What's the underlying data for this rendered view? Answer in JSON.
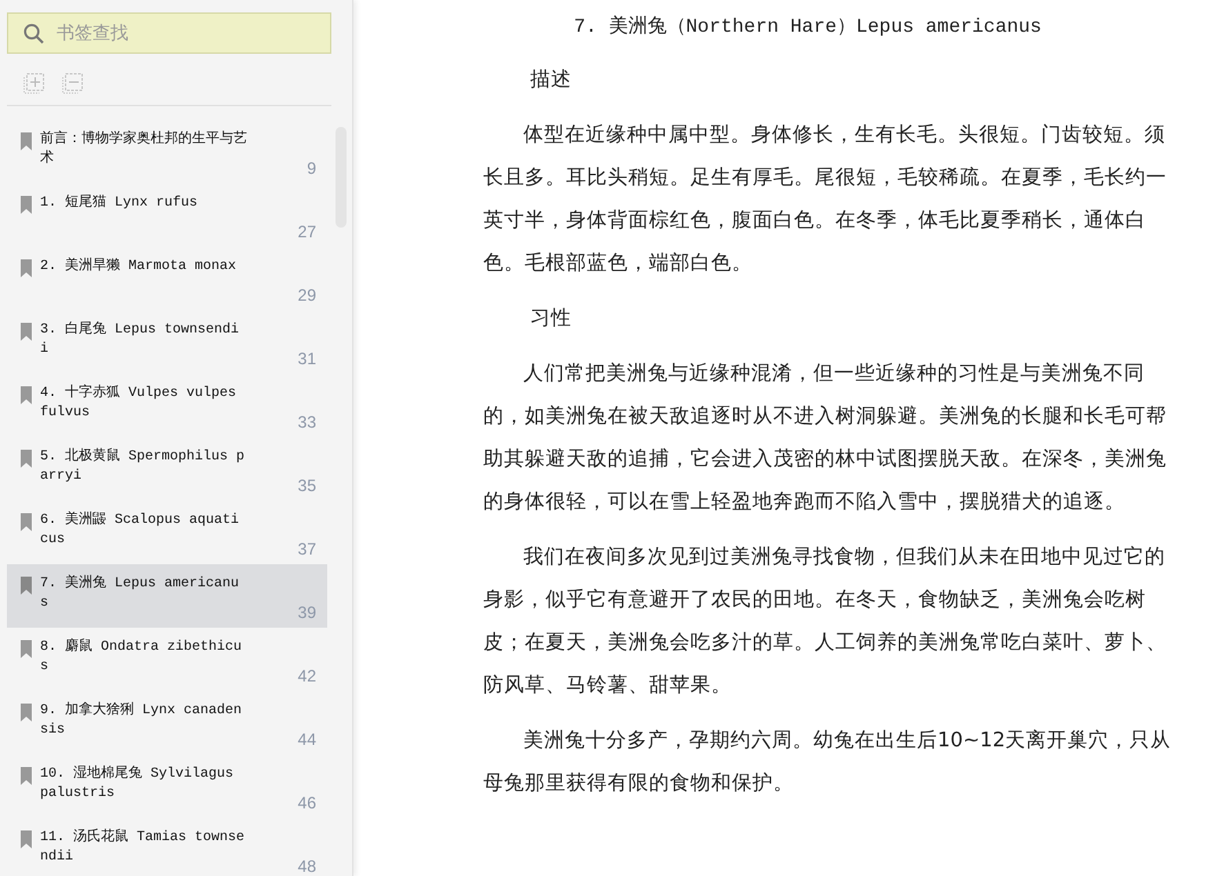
{
  "sidebar": {
    "search": {
      "placeholder": "书签查找"
    },
    "bookmarks": [
      {
        "title": "前言：博物学家奥杜邦的生平与艺术",
        "page": "9",
        "selected": false
      },
      {
        "title": "1. 短尾猫 Lynx rufus",
        "page": "27",
        "selected": false
      },
      {
        "title": "2. 美洲旱獭 Marmota monax",
        "page": "29",
        "selected": false
      },
      {
        "title": "3. 白尾兔 Lepus townsendii",
        "page": "31",
        "selected": false
      },
      {
        "title": "4. 十字赤狐 Vulpes vulpes fulvus",
        "page": "33",
        "selected": false
      },
      {
        "title": "5. 北极黄鼠 Spermophilus parryi",
        "page": "35",
        "selected": false
      },
      {
        "title": "6. 美洲鼹 Scalopus aquaticus",
        "page": "37",
        "selected": false
      },
      {
        "title": "7. 美洲兔 Lepus americanus",
        "page": "39",
        "selected": true
      },
      {
        "title": "8. 麝鼠 Ondatra zibethicus",
        "page": "42",
        "selected": false
      },
      {
        "title": "9. 加拿大猞猁 Lynx canadensis",
        "page": "44",
        "selected": false
      },
      {
        "title": "10. 湿地棉尾兔 Sylvilagus palustris",
        "page": "46",
        "selected": false
      },
      {
        "title": "11. 汤氏花鼠 Tamias townsendii",
        "page": "48",
        "selected": false
      }
    ]
  },
  "content": {
    "title": "7. 美洲兔（Northern Hare）Lepus americanus",
    "blocks": [
      {
        "kind": "heading",
        "text": "描述"
      },
      {
        "kind": "paragraph",
        "text": "体型在近缘种中属中型。身体修长，生有长毛。头很短。门齿较短。须长且多。耳比头稍短。足生有厚毛。尾很短，毛较稀疏。在夏季，毛长约一英寸半，身体背面棕红色，腹面白色。在冬季，体毛比夏季稍长，通体白色。毛根部蓝色，端部白色。"
      },
      {
        "kind": "heading",
        "text": "习性"
      },
      {
        "kind": "paragraph",
        "text": "人们常把美洲兔与近缘种混淆，但一些近缘种的习性是与美洲兔不同的，如美洲兔在被天敌追逐时从不进入树洞躲避。美洲兔的长腿和长毛可帮助其躲避天敌的追捕，它会进入茂密的林中试图摆脱天敌。在深冬，美洲兔的身体很轻，可以在雪上轻盈地奔跑而不陷入雪中，摆脱猎犬的追逐。"
      },
      {
        "kind": "paragraph",
        "text": "我们在夜间多次见到过美洲兔寻找食物，但我们从未在田地中见过它的身影，似乎它有意避开了农民的田地。在冬天，食物缺乏，美洲兔会吃树皮；在夏天，美洲兔会吃多汁的草。人工饲养的美洲兔常吃白菜叶、萝卜、防风草、马铃薯、甜苹果。"
      },
      {
        "kind": "paragraph",
        "text": "美洲兔十分多产，孕期约六周。幼兔在出生后10~12天离开巢穴，只从母兔那里获得有限的食物和保护。"
      }
    ]
  }
}
